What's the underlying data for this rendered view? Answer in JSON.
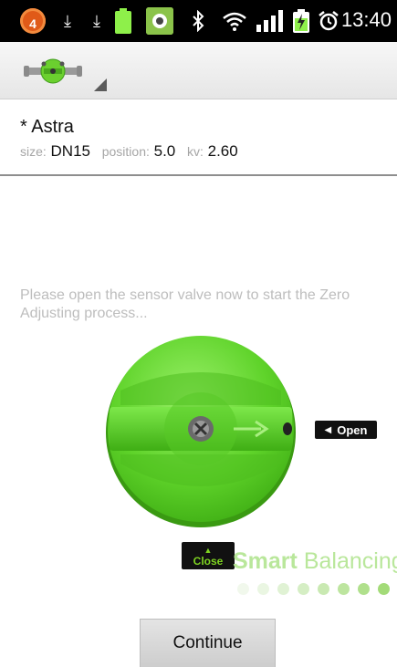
{
  "status_bar": {
    "notification_count": "4",
    "time": "13:40",
    "icons": [
      "download-icon",
      "download-icon",
      "battery-icon",
      "app-notification-icon",
      "bluetooth-icon",
      "wifi-icon",
      "signal-icon",
      "battery-charging-icon",
      "alarm-icon"
    ]
  },
  "action_bar": {
    "logo_icon": "valve-logo-icon"
  },
  "valve": {
    "name": "* Astra",
    "size_label": "size:",
    "size_value": "DN15",
    "position_label": "position:",
    "position_value": "5.0",
    "kv_label": "kv:",
    "kv_value": "2.60"
  },
  "instruction": "Please open the sensor valve now to start the Zero Adjusting process...",
  "wheel": {
    "open_label": "Open",
    "close_label": "Close"
  },
  "brand": {
    "bold": "Smart",
    "regular": " Balancing"
  },
  "continue_label": "Continue",
  "colors": {
    "accent_green": "#7ed321",
    "wheel_green": "#5fd32a",
    "muted_text": "#bdbdbd"
  }
}
